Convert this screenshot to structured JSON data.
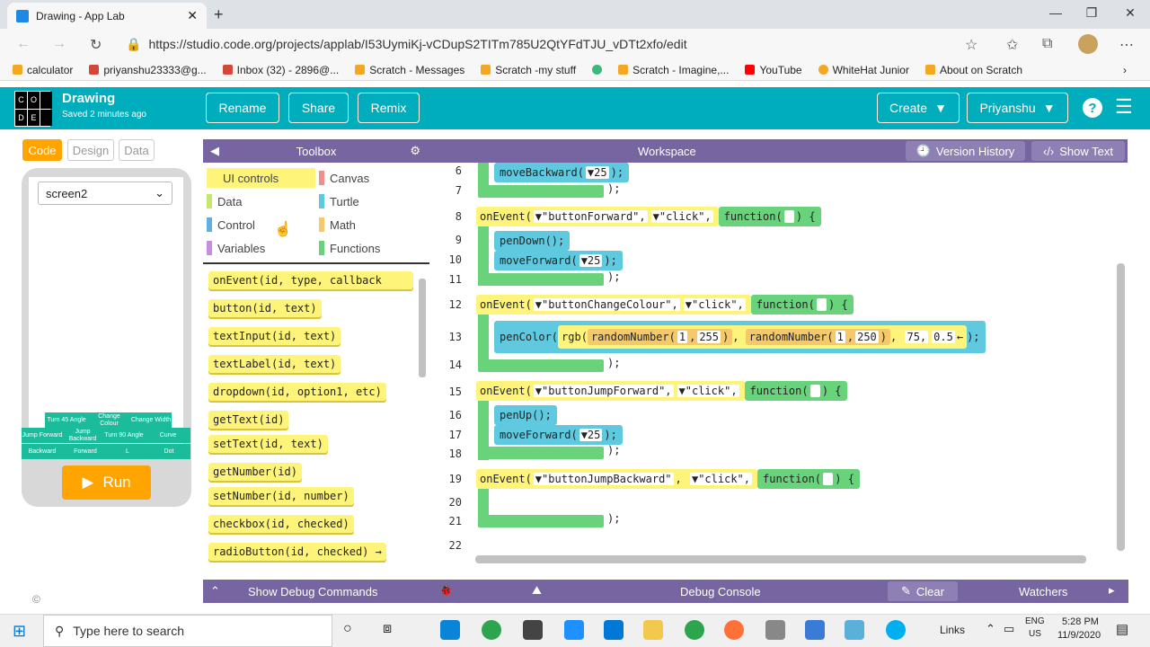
{
  "browser": {
    "tab_title": "Drawing - App Lab",
    "url": "https://studio.code.org/projects/applab/I53UymiKj-vCDupS2TITm785U2QtYFdTJU_vDTt2xfo/edit",
    "bookmarks": [
      {
        "label": "calculator",
        "color": "#f5a623"
      },
      {
        "label": "priyanshu23333@g...",
        "color": "#d44638"
      },
      {
        "label": "Inbox (32) - 2896@...",
        "color": "#d44638"
      },
      {
        "label": "Scratch - Messages",
        "color": "#f5a623"
      },
      {
        "label": "Scratch -my stuff",
        "color": "#f5a623"
      },
      {
        "label": "",
        "color": "#3cb878"
      },
      {
        "label": "Scratch - Imagine,...",
        "color": "#f5a623"
      },
      {
        "label": "YouTube",
        "color": "#ff0000"
      },
      {
        "label": "WhiteHat Junior",
        "color": "#f5a623"
      },
      {
        "label": "About on Scratch",
        "color": "#f5a623"
      }
    ]
  },
  "app": {
    "logo": [
      "C",
      "O",
      "D",
      "E"
    ],
    "project_name": "Drawing",
    "saved_status": "Saved 2 minutes ago",
    "buttons": {
      "rename": "Rename",
      "share": "Share",
      "remix": "Remix",
      "create": "Create",
      "user": "Priyanshu"
    },
    "header_color": "#00adbc"
  },
  "left": {
    "tabs": {
      "code": "Code",
      "design": "Design",
      "data": "Data"
    },
    "screen_select": "screen2",
    "design_buttons": [
      {
        "label": "Turn 45 Angle"
      },
      {
        "label": "Change Colour"
      },
      {
        "label": "Change Width"
      },
      {
        "label": "Jump Forward"
      },
      {
        "label": "Jump Backward"
      },
      {
        "label": "Turn 90 Angle"
      },
      {
        "label": "Curve"
      },
      {
        "label": "Backward"
      },
      {
        "label": "Forward"
      },
      {
        "label": "L"
      },
      {
        "label": "Dot"
      }
    ],
    "run_label": "Run"
  },
  "toolbox": {
    "title": "Toolbox",
    "categories": [
      {
        "label": "UI controls",
        "color": "#fff47a"
      },
      {
        "label": "Canvas",
        "color": "#f18e8e"
      },
      {
        "label": "Data",
        "color": "#c5e86c"
      },
      {
        "label": "Turtle",
        "color": "#5fc9e0"
      },
      {
        "label": "Control",
        "color": "#5fb0e0"
      },
      {
        "label": "Math",
        "color": "#f5c969"
      },
      {
        "label": "Variables",
        "color": "#c68ee0"
      },
      {
        "label": "Functions",
        "color": "#68d37a"
      }
    ],
    "blocks": [
      "onEvent(id, type, callback",
      "button(id, text)",
      "textInput(id, text)",
      "textLabel(id, text)",
      "dropdown(id, option1, etc)",
      "getText(id)",
      "setText(id, text)",
      "getNumber(id)",
      "setNumber(id, number)",
      "checkbox(id, checked)",
      "radioButton(id, checked) →"
    ]
  },
  "workspace": {
    "title": "Workspace",
    "version_history": "Version History",
    "show_text": "Show Text",
    "line_numbers": [
      "6",
      "7",
      "8",
      "9",
      "10",
      "11",
      "12",
      "13",
      "14",
      "15",
      "16",
      "17",
      "18",
      "19",
      "20",
      "21",
      "22"
    ],
    "code": {
      "l6": {
        "fn": "moveBackward(",
        "arg": "▼25",
        "end": ");"
      },
      "l8": {
        "a": "onEvent(",
        "id": "▼\"buttonForward\",",
        "ev": "▼\"click\",",
        "fn": "function(",
        "end": ") {"
      },
      "l9": "penDown();",
      "l10": {
        "fn": "moveForward(",
        "arg": "▼25",
        "end": ");"
      },
      "l12": {
        "a": "onEvent(",
        "id": "▼\"buttonChangeColour\",",
        "ev": "▼\"click\",",
        "fn": "function(",
        "end": ") {"
      },
      "l13": {
        "fn": "penColor(",
        "rgb": "rgb(",
        "r1": "randomNumber(",
        "r1a": "1",
        "r1b": "255",
        "r2": "randomNumber(",
        "r2a": "1",
        "r2b": "250",
        "v1": "75,",
        "v2": "0.5",
        "end": ");"
      },
      "l15": {
        "a": "onEvent(",
        "id": "▼\"buttonJumpForward\",",
        "ev": "▼\"click\",",
        "fn": "function(",
        "end": ") {"
      },
      "l16": "penUp();",
      "l17": {
        "fn": "moveForward(",
        "arg": "▼25",
        "end": ");"
      },
      "l19": {
        "a": "onEvent(",
        "id": "▼\"buttonJumpBackward\"",
        "ev": "▼\"click\",",
        "fn": "function(",
        "end": ") {"
      },
      "close": ");"
    }
  },
  "bottom": {
    "debug_commands": "Show Debug Commands",
    "debug_console": "Debug Console",
    "clear": "Clear",
    "watchers": "Watchers"
  },
  "taskbar": {
    "search": "Type here to search",
    "links": "Links",
    "lang": "ENG",
    "region": "US",
    "time": "5:28 PM",
    "date": "11/9/2020"
  }
}
